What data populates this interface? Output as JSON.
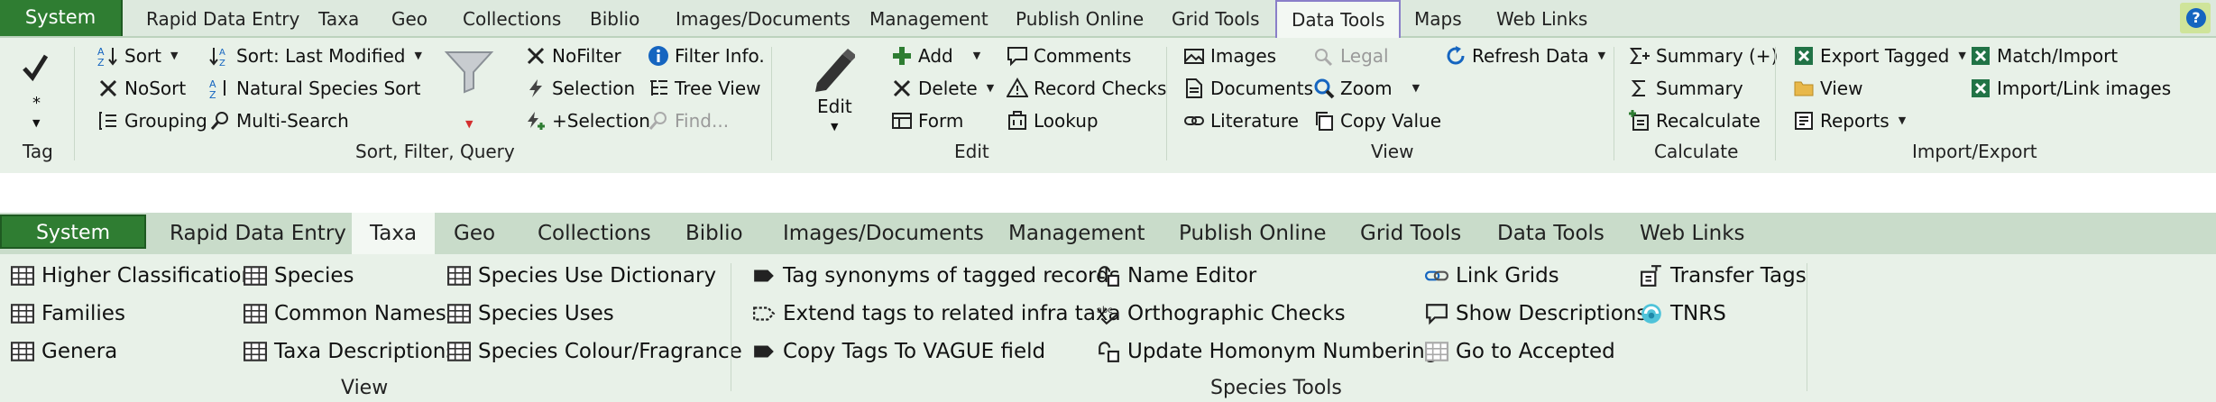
{
  "ribbon1": {
    "system_tab": "System",
    "tabs": [
      "Rapid Data Entry",
      "Taxa",
      "Geo",
      "Collections",
      "Biblio",
      "Images/Documents",
      "Management",
      "Publish Online",
      "Grid Tools",
      "Data Tools",
      "Maps",
      "Web Links"
    ],
    "active_tab": "Data Tools",
    "help_label": "?",
    "groups": {
      "tag": {
        "label": "Tag",
        "star": "*"
      },
      "sort": {
        "label": "Sort, Filter, Query",
        "sort": "Sort",
        "sort_last_modified": "Sort: Last Modified",
        "nosort": "NoSort",
        "natural_species_sort": "Natural Species Sort",
        "grouping": "Grouping",
        "multi_search": "Multi-Search",
        "nofilter": "NoFilter",
        "selection": "Selection",
        "plus_selection": "+Selection",
        "filter_info": "Filter Info.",
        "tree_view": "Tree View",
        "find": "Find..."
      },
      "edit": {
        "label": "Edit",
        "edit": "Edit",
        "add": "Add",
        "delete": "Delete",
        "form": "Form",
        "comments": "Comments",
        "record_checks": "Record Checks",
        "lookup": "Lookup"
      },
      "view": {
        "label": "View",
        "images": "Images",
        "documents": "Documents",
        "literature": "Literature",
        "legal": "Legal",
        "zoom": "Zoom",
        "copy_value": "Copy Value",
        "refresh_data": "Refresh Data"
      },
      "calculate": {
        "label": "Calculate",
        "summary_plus": "Summary (+)",
        "summary": "Summary",
        "recalculate": "Recalculate"
      },
      "import_export": {
        "label": "Import/Export",
        "export_tagged": "Export Tagged",
        "view": "View",
        "reports": "Reports",
        "match_import": "Match/Import",
        "import_link_images": "Import/Link images"
      }
    }
  },
  "ribbon2": {
    "system_tab": "System",
    "tabs": [
      "Rapid Data Entry",
      "Taxa",
      "Geo",
      "Collections",
      "Biblio",
      "Images/Documents",
      "Management",
      "Publish Online",
      "Grid Tools",
      "Data Tools",
      "Web Links"
    ],
    "active_tab": "Taxa",
    "groups": {
      "view": {
        "label": "View",
        "higher_classification": "Higher Classification",
        "families": "Families",
        "genera": "Genera",
        "species": "Species",
        "common_names": "Common Names",
        "taxa_descriptions": "Taxa Descriptions",
        "species_use_dictionary": "Species Use Dictionary",
        "species_uses": "Species Uses",
        "species_colour_fragrance": "Species Colour/Fragrance"
      },
      "species_tools": {
        "label": "Species Tools",
        "tag_synonyms": "Tag synonyms of tagged records",
        "extend_tags": "Extend tags to related infra taxa",
        "copy_tags_vague": "Copy Tags To VAGUE field",
        "name_editor": "Name Editor",
        "orthographic_checks": "Orthographic Checks",
        "update_homonym_numbering": "Update Homonym Numbering",
        "link_grids": "Link Grids",
        "show_descriptions": "Show Descriptions",
        "go_to_accepted": "Go to Accepted",
        "transfer_tags": "Transfer Tags",
        "tnrs": "TNRS"
      }
    }
  },
  "colors": {
    "ribbon_bg": "#e8f1e8",
    "system_tab": "#2f7d32",
    "active_tab_border": "#8a7fc9",
    "disabled_text": "#9a9a9a",
    "accent_blue": "#1565c0"
  }
}
